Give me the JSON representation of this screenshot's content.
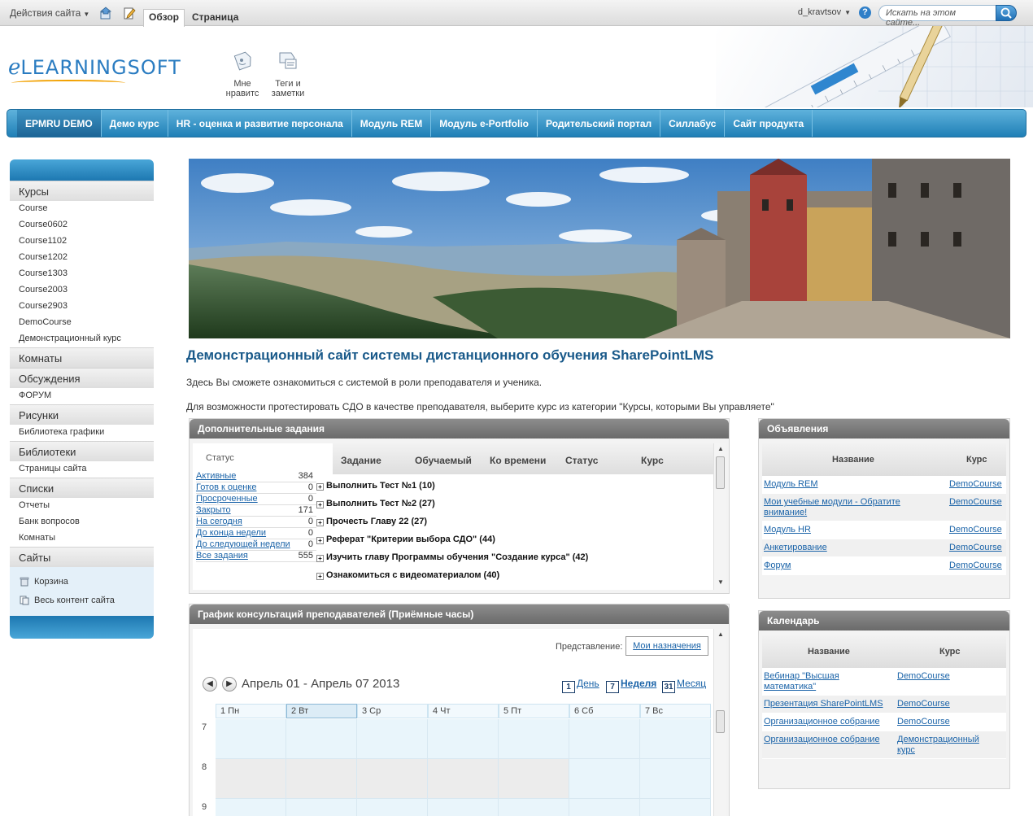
{
  "ribbon": {
    "site_actions": "Действия сайта",
    "tab_browse": "Обзор",
    "tab_page": "Страница",
    "user": "d_kravtsov",
    "search_placeholder": "Искать на этом сайте..."
  },
  "header": {
    "logo_e": "e",
    "logo_rest": "LEARNINGSOFT",
    "like_label": "Мне нравитс",
    "tags_label": "Теги и заметки"
  },
  "topnav": [
    "EPMRU DEMO",
    "Демо курс",
    "HR - оценка и развитие персонала",
    "Модуль REM",
    "Модуль e-Portfolio",
    "Родительский портал",
    "Силлабус",
    "Сайт продукта"
  ],
  "leftnav": {
    "courses_header": "Курсы",
    "courses": [
      "Course",
      "Course0602",
      "Course1102",
      "Course1202",
      "Course1303",
      "Course2003",
      "Course2903",
      "DemoCourse",
      "Демонстрационный курс"
    ],
    "rooms_header": "Комнаты",
    "discussions_header": "Обсуждения",
    "discussions": [
      "ФОРУМ"
    ],
    "pictures_header": "Рисунки",
    "pictures": [
      "Библиотека графики"
    ],
    "libraries_header": "Библиотеки",
    "libraries": [
      "Страницы сайта"
    ],
    "lists_header": "Списки",
    "lists": [
      "Отчеты",
      "Банк вопросов",
      "Комнаты"
    ],
    "sites_header": "Сайты",
    "recycle_bin": "Корзина",
    "all_content": "Весь контент сайта"
  },
  "main": {
    "title": "Демонстрационный сайт системы дистанционного обучения SharePointLMS",
    "intro1": "Здесь Вы сможете ознакомиться с системой в роли преподавателя и ученика.",
    "intro2": "Для возможности протестировать СДО в качестве преподавателя, выберите курс из категории \"Курсы, которыми Вы управляете\""
  },
  "tasks": {
    "title": "Дополнительные задания",
    "status_label": "Статус",
    "statuses": [
      {
        "name": "Активные",
        "count": "384"
      },
      {
        "name": "Готов к оценке",
        "count": "0"
      },
      {
        "name": "Просроченные",
        "count": "0"
      },
      {
        "name": "Закрыто",
        "count": "171"
      },
      {
        "name": "На сегодня",
        "count": "0"
      },
      {
        "name": "До конца недели",
        "count": "0"
      },
      {
        "name": "До следующей недели",
        "count": "0"
      },
      {
        "name": "Все задания",
        "count": "555"
      }
    ],
    "columns": [
      "Задание",
      "Обучаемый",
      "Ко времени",
      "Статус",
      "Курс"
    ],
    "rows": [
      "Выполнить Тест №1 (10)",
      "Выполнить Тест №2 (27)",
      "Прочесть Главу 22 (27)",
      "Реферат \"Критерии выбора СДО\" (44)",
      "Изучить главу Программы обучения \"Создание курса\" (42)",
      "Ознакомиться с видеоматериалом (40)"
    ]
  },
  "announcements": {
    "title": "Объявления",
    "col_name": "Название",
    "col_course": "Курс",
    "rows": [
      {
        "name": "Модуль REM",
        "course": "DemoCourse"
      },
      {
        "name": "Мои учебные модули - Обратите внимание!",
        "course": "DemoCourse"
      },
      {
        "name": "Модуль HR",
        "course": "DemoCourse"
      },
      {
        "name": "Анкетирование",
        "course": "DemoCourse"
      },
      {
        "name": "Форум",
        "course": "DemoCourse"
      }
    ]
  },
  "calendar": {
    "title": "Календарь",
    "col_name": "Название",
    "col_course": "Курс",
    "rows": [
      {
        "name": "Вебинар \"Высшая математика\"",
        "course": "DemoCourse"
      },
      {
        "name": "Презентация SharePointLMS",
        "course": "DemoCourse"
      },
      {
        "name": "Организационное собрание",
        "course": "DemoCourse"
      },
      {
        "name": "Организационное собрание",
        "course": "Демонстрационный курс"
      }
    ]
  },
  "schedule": {
    "title": "График консультаций преподавателей (Приёмные часы)",
    "view_label": "Представление:",
    "view_value": "Мои назначения",
    "range": "Апрель 01 - Апрель 07 2013",
    "modes": [
      {
        "icon": "1",
        "label": "День"
      },
      {
        "icon": "7",
        "label": "Неделя"
      },
      {
        "icon": "31",
        "label": "Месяц"
      }
    ],
    "days": [
      "1 Пн",
      "2 Вт",
      "3 Ср",
      "4 Чт",
      "5 Пт",
      "6 Сб",
      "7 Вс"
    ],
    "hours": [
      "7",
      "8",
      "9"
    ],
    "today_index": 1
  },
  "colors": {
    "nav_blue": "#1f7fb6",
    "link": "#1a63a8",
    "title": "#1a5a8a",
    "webpart_header": "#6a6a6a"
  }
}
